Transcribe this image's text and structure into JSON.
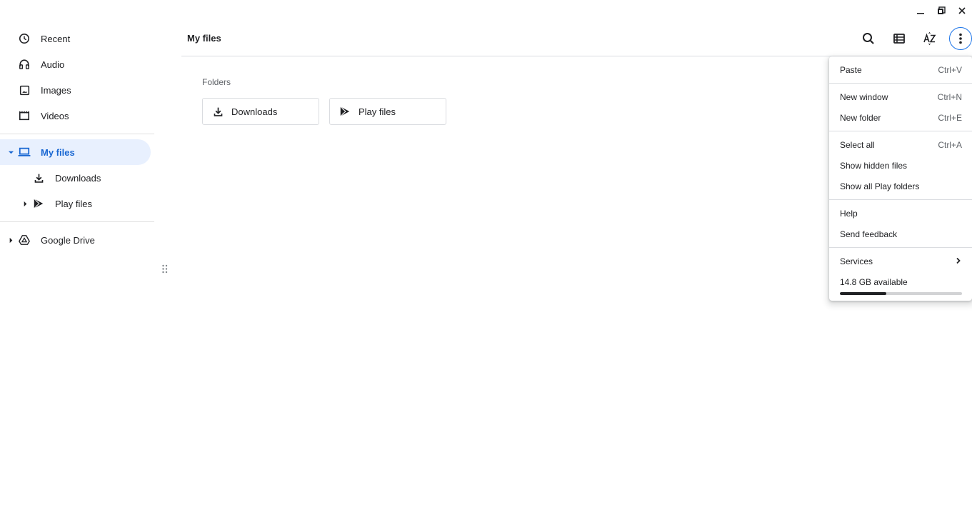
{
  "window": {
    "controls": [
      {
        "name": "minimize-button",
        "icon": "minimize-icon"
      },
      {
        "name": "restore-button",
        "icon": "restore-icon"
      },
      {
        "name": "close-button",
        "icon": "close-icon"
      }
    ]
  },
  "sidebar": {
    "items": [
      {
        "label": "Recent",
        "icon": "clock-icon"
      },
      {
        "label": "Audio",
        "icon": "headphones-icon"
      },
      {
        "label": "Images",
        "icon": "image-icon"
      },
      {
        "label": "Videos",
        "icon": "video-icon"
      },
      {
        "label": "My files",
        "icon": "laptop-icon",
        "selected": true,
        "expanded": true
      },
      {
        "label": "Downloads",
        "icon": "download-icon"
      },
      {
        "label": "Play files",
        "icon": "play-store-icon",
        "expanded": false
      },
      {
        "label": "Google Drive",
        "icon": "drive-icon",
        "expanded": false
      }
    ]
  },
  "header": {
    "title": "My files",
    "toolbar": {
      "search": "search-icon",
      "view": "list-view-icon",
      "sort": "sort-az-icon",
      "more": "more-vert-icon"
    }
  },
  "content": {
    "section_label": "Folders",
    "folders": [
      {
        "label": "Downloads",
        "icon": "download-icon"
      },
      {
        "label": "Play files",
        "icon": "play-store-icon"
      }
    ]
  },
  "menu": {
    "groups": [
      [
        {
          "label": "Paste",
          "shortcut": "Ctrl+V"
        }
      ],
      [
        {
          "label": "New window",
          "shortcut": "Ctrl+N"
        },
        {
          "label": "New folder",
          "shortcut": "Ctrl+E"
        }
      ],
      [
        {
          "label": "Select all",
          "shortcut": "Ctrl+A"
        },
        {
          "label": "Show hidden files",
          "shortcut": ""
        },
        {
          "label": "Show all Play folders",
          "shortcut": ""
        }
      ],
      [
        {
          "label": "Help",
          "shortcut": ""
        },
        {
          "label": "Send feedback",
          "shortcut": ""
        }
      ],
      [
        {
          "label": "Services",
          "submenu": true
        }
      ]
    ],
    "storage": {
      "label": "14.8 GB available",
      "used_fraction": 0.38
    }
  },
  "colors": {
    "accent": "#1a73e8",
    "selected_bg": "#e8f0fe",
    "selected_text": "#1967d2"
  }
}
